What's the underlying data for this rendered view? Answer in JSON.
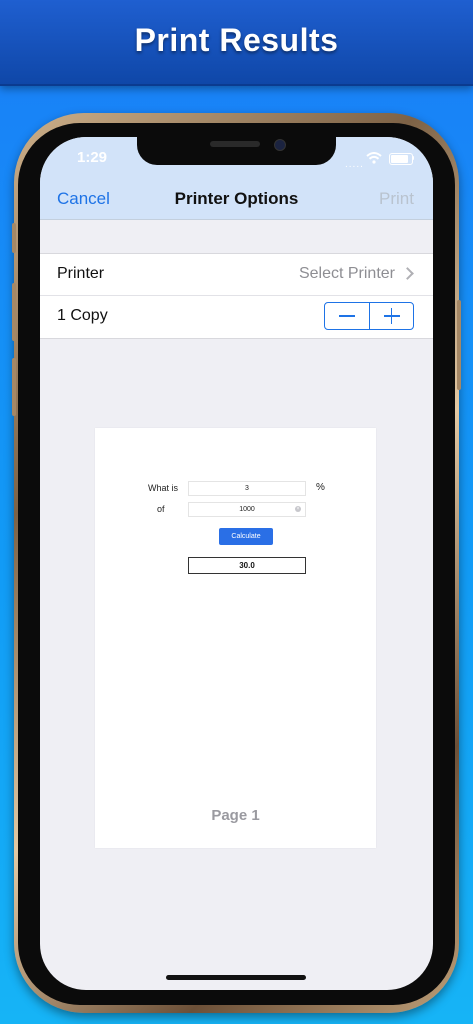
{
  "banner": {
    "title": "Print Results"
  },
  "status": {
    "time": "1:29",
    "signal": "....."
  },
  "nav": {
    "cancel": "Cancel",
    "title": "Printer Options",
    "print": "Print"
  },
  "options": {
    "printer_label": "Printer",
    "printer_value": "Select Printer",
    "copies_label": "1 Copy"
  },
  "preview": {
    "what_is_label": "What is",
    "field_1_value": "3",
    "percent_symbol": "%",
    "of_label": "of",
    "field_2_value": "1000",
    "calculate_label": "Calculate",
    "result_value": "30.0",
    "clear_glyph": "×",
    "page_label": "Page 1"
  },
  "colors": {
    "accent": "#1e73e6",
    "banner": "#0f47a8",
    "background": "#129bf6"
  }
}
